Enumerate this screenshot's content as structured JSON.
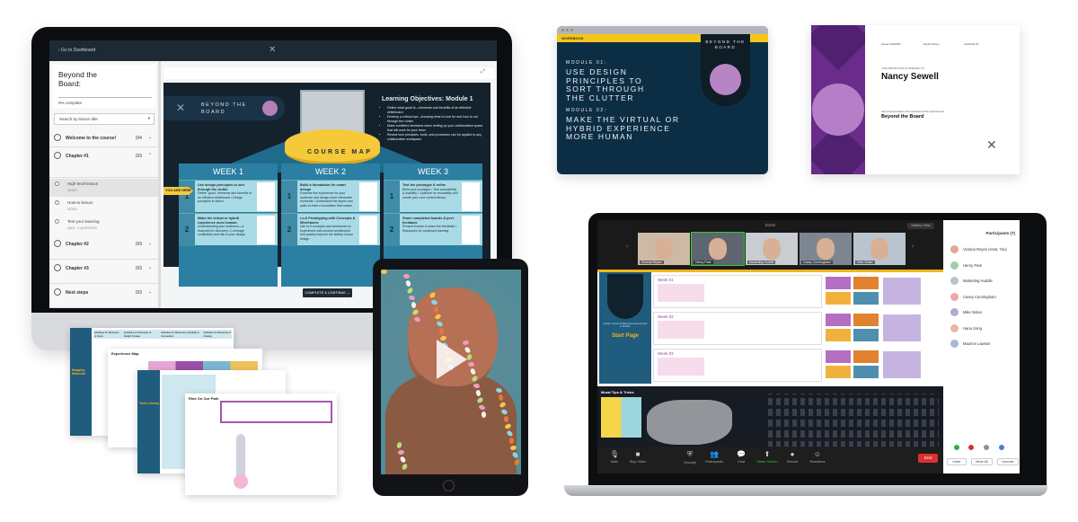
{
  "lms": {
    "back_link": "‹ Go to Dashboard",
    "course_title": "Beyond the Board:",
    "progress_text": "0% complete",
    "progress": 0,
    "search_placeholder": "Search by lesson title",
    "chapters": [
      {
        "name": "Welcome to the course!",
        "count": "0/4"
      },
      {
        "name": "Chapter #1",
        "count": "0/3"
      },
      {
        "name": "Chapter #2",
        "count": "0/3"
      },
      {
        "name": "Chapter #3",
        "count": "0/3"
      },
      {
        "name": "Next steps",
        "count": "0/3"
      }
    ],
    "lessons": [
      {
        "name": "High-level lesson",
        "type": "VIDEO"
      },
      {
        "name": "How-to lesson",
        "type": "VIDEO"
      },
      {
        "name": "Test your learning",
        "type": "QUIZ · 1 QUESTION"
      }
    ],
    "complete_button": "COMPLETE & CONTINUE →"
  },
  "course_map": {
    "brand": "BEYOND THE BOARD",
    "stage_label": "COURSE MAP",
    "objectives_title": "Learning Objectives: Module 1",
    "objectives": [
      "Define what good is—elements and benefits of an effective whiteboard",
      "Develop a critical eye—knowing what to look for and how to cut through the clutter",
      "Make confident decisions when setting up your collaborative space that will work for your team",
      "Reveal how principles, tools, and processes can be applied to any collaborative workspace"
    ],
    "you_are_here": "YOU ARE HERE",
    "weeks": [
      {
        "label": "WEEK 1",
        "rows": [
          {
            "num": "1",
            "title": "Use design principles to sort through the clutter",
            "body": "Define 'good,' elements and benefits of an effective whiteboard • Design principles in action"
          },
          {
            "num": "2",
            "title": "Make the virtual or hybrid experience more human",
            "body": "Understanding your audience—a blueprint for discovery • Leverage constraints and risk in your design"
          }
        ]
      },
      {
        "label": "WEEK 2",
        "rows": [
          {
            "num": "1",
            "title": "Build a foundation for smart design",
            "body": "Examine the experience for your audience and design more interactive moments • Understand the layers and parts to build a foundation that scales"
          },
          {
            "num": "2",
            "title": "Lo-fi Prototyping with Concepts & Wireframes",
            "body": "Use lo-fi concepts and wireframes to experiment with content architecture and quickly improve the fidelity of your design"
          }
        ]
      },
      {
        "label": "WEEK 3",
        "rows": [
          {
            "num": "1",
            "title": "Test the prototype & refine",
            "body": "Build your prototype • Test accessibility & usability • Optimize for reusability and create your core content library"
          },
          {
            "num": "2",
            "title": "Share completed boards & peer feedback",
            "body": "Present boards & share live feedback • Resources for continued learning"
          }
        ]
      }
    ]
  },
  "workbook": {
    "tab": "WORKBOOK",
    "brand": "BEYOND THE BOARD",
    "module1_label": "MODULE 01:",
    "module1_title": "USE DESIGN PRINCIPLES TO SORT THROUGH THE CLUTTER",
    "module2_label": "MODULE 02:",
    "module2_title": "MAKE THE VIRTUAL OR HYBRID EXPERIENCE MORE HUMAN"
  },
  "certificate": {
    "issued": "Issued 4/19/2022",
    "expires": "Expires Never",
    "certificate_id": "Certificate ID",
    "awarded_to": "THIS CERTIFICATE IS AWARDED TO",
    "name": "Nancy Sewell",
    "statement": "Has pursued studies and completed all the requirements",
    "course": "Beyond the Board",
    "logo": "WE ARE"
  },
  "worksheets": {
    "experience_map": "Experience Map",
    "ride_on_our_path": "Ride On Our Path",
    "columns": [
      "Activities for Moments to Open",
      "Activities for Moments of Insight & Ideas",
      "Activities for Moments of Delight & Connection",
      "Activities for Moments of Closing"
    ],
    "mapping_moments": "Mapping Moments",
    "tools_library": "Tools Library"
  },
  "zoom": {
    "window_title": "Zoom",
    "gallery_view": "Gallery View",
    "tiles": [
      "Victoria Reyes",
      "Henry Park",
      "Marketing Huddle",
      "Casey Cunningham",
      "Mike Nolan"
    ],
    "mural": {
      "brand": "BEYOND THE BOARD",
      "subtitle": "Design Inspired Collaborative Experiences in MURAL",
      "start_page": "Start Page",
      "weeks": [
        "Week 01",
        "Week 02",
        "Week 03"
      ],
      "tips": "Mural Tips & Tricks",
      "where": "Where in the world"
    },
    "toolbar": [
      {
        "label": "Mute",
        "icon": "🎙"
      },
      {
        "label": "Stop Video",
        "icon": "■"
      },
      {
        "label": "Security",
        "icon": "⛨"
      },
      {
        "label": "Participants",
        "icon": "👥"
      },
      {
        "label": "Chat",
        "icon": "💬"
      },
      {
        "label": "Share Screen",
        "icon": "⬆"
      },
      {
        "label": "Record",
        "icon": "●"
      },
      {
        "label": "Reactions",
        "icon": "☺"
      }
    ],
    "end": "End",
    "participants_title": "Participants (7)",
    "participants": [
      "Victoria Reyes (Host, You)",
      "Henry Park",
      "Marketing Huddle",
      "Casey Cunningham",
      "Mike Nolan",
      "Hana Song",
      "Maurice Lawson"
    ],
    "panel_buttons": [
      "Invite",
      "Mute All",
      "Unmute"
    ],
    "accent": "#f5b51b",
    "end_color": "#d83231"
  }
}
